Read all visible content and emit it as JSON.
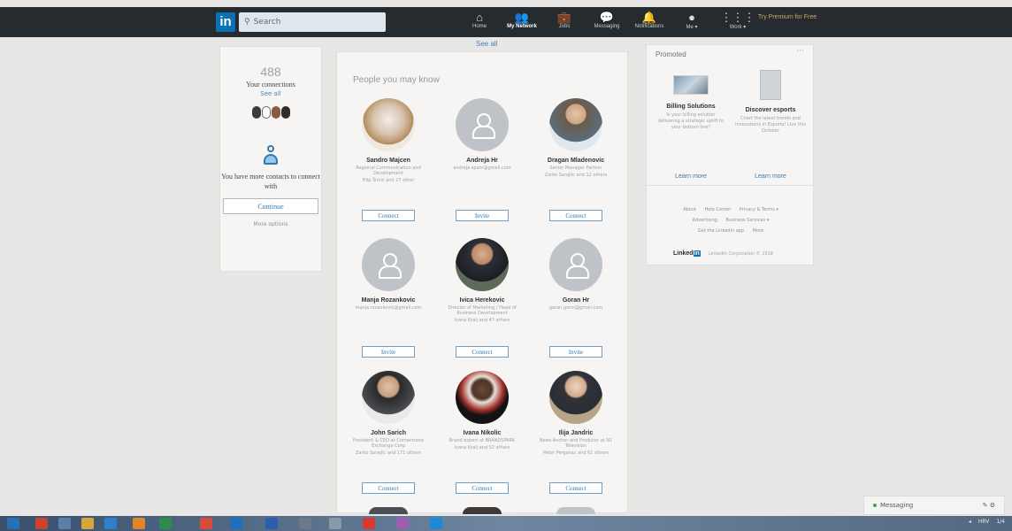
{
  "nav": {
    "logo": "in",
    "search_placeholder": "Search",
    "items": [
      {
        "icon": "home-icon",
        "glyph": "⌂",
        "label": "Home"
      },
      {
        "icon": "network-icon",
        "glyph": "👥",
        "label": "My Network"
      },
      {
        "icon": "jobs-icon",
        "glyph": "💼",
        "label": "Jobs"
      },
      {
        "icon": "messaging-icon",
        "glyph": "💬",
        "label": "Messaging"
      },
      {
        "icon": "notifications-icon",
        "glyph": "🔔",
        "label": "Notifications"
      },
      {
        "icon": "me-icon",
        "glyph": "●",
        "label": "Me ▾"
      },
      {
        "icon": "work-icon",
        "glyph": "⋮⋮⋮",
        "label": "Work ▾"
      }
    ],
    "premium": "Try Premium for Free"
  },
  "left": {
    "count": "488",
    "label": "Your connections",
    "see_all": "See all",
    "more_contacts": "You have more contacts to connect with",
    "continue": "Continue",
    "more_options": "More options"
  },
  "center": {
    "see_all": "See all",
    "heading": "People you may know",
    "people": [
      {
        "name": "Sandro Majcen",
        "title": "Regional Communication and Development",
        "mutual": "Filip Šimić and 27 other",
        "button": "Connect"
      },
      {
        "name": "Andreja Hr",
        "title": "andreja.spam@gmail.com",
        "mutual": "",
        "button": "Invite"
      },
      {
        "name": "Dragan Mladenovic",
        "title": "Senior Manager Partner",
        "mutual": "Zarko Sarajlic and 12 others",
        "button": "Connect"
      },
      {
        "name": "Manja Rozankovic",
        "title": "manja.rozankovic@gmail.com",
        "mutual": "",
        "button": "Invite"
      },
      {
        "name": "Ivica Herekovic",
        "title": "Director of Marketing / Head of Business Development",
        "mutual": "Ivana Kralj and 47 others",
        "button": "Connect"
      },
      {
        "name": "Goran Hr",
        "title": "goran.gorm@gmail.com",
        "mutual": "",
        "button": "Invite"
      },
      {
        "name": "John Sarich",
        "title": "President & CEO at Cornerstone Exchange Corp",
        "mutual": "Zarko Sarajlic and 171 others",
        "button": "Connect"
      },
      {
        "name": "Ivana Nikolic",
        "title": "Brand expert at BRANDSPARK",
        "mutual": "Ivana Kralj and 52 others",
        "button": "Connect"
      },
      {
        "name": "Ilija Jandric",
        "title": "News Anchor and Producer at N1 Television",
        "mutual": "Peter Pergovac and 61 others",
        "button": "Connect"
      }
    ]
  },
  "promo": {
    "label": "Promoted",
    "more": "···",
    "ads": [
      {
        "title": "Billing Solutions",
        "desc": "Is your billing solution delivering a strategic uplift to your bottom line?",
        "link": "Learn more"
      },
      {
        "title": "Discover esports",
        "desc": "Chart the latest trends and innovations in Esports! Live this October",
        "link": "Learn more"
      }
    ],
    "footer": [
      "About",
      "Help Center",
      "Privacy & Terms ▾",
      "Advertising",
      "Business Services ▾",
      "Get the LinkedIn app",
      "More"
    ],
    "brand": "Linked",
    "brand_in": "in",
    "copyright": "LinkedIn Corporation © 2018"
  },
  "messaging": {
    "label": "Messaging"
  },
  "taskbar": {
    "tray_lang": "HRV",
    "time": "1/4"
  },
  "colors": {
    "brand": "#0a72b0",
    "nav_bg": "#262b30",
    "link": "#2f79b1",
    "premium": "#d3a566"
  }
}
